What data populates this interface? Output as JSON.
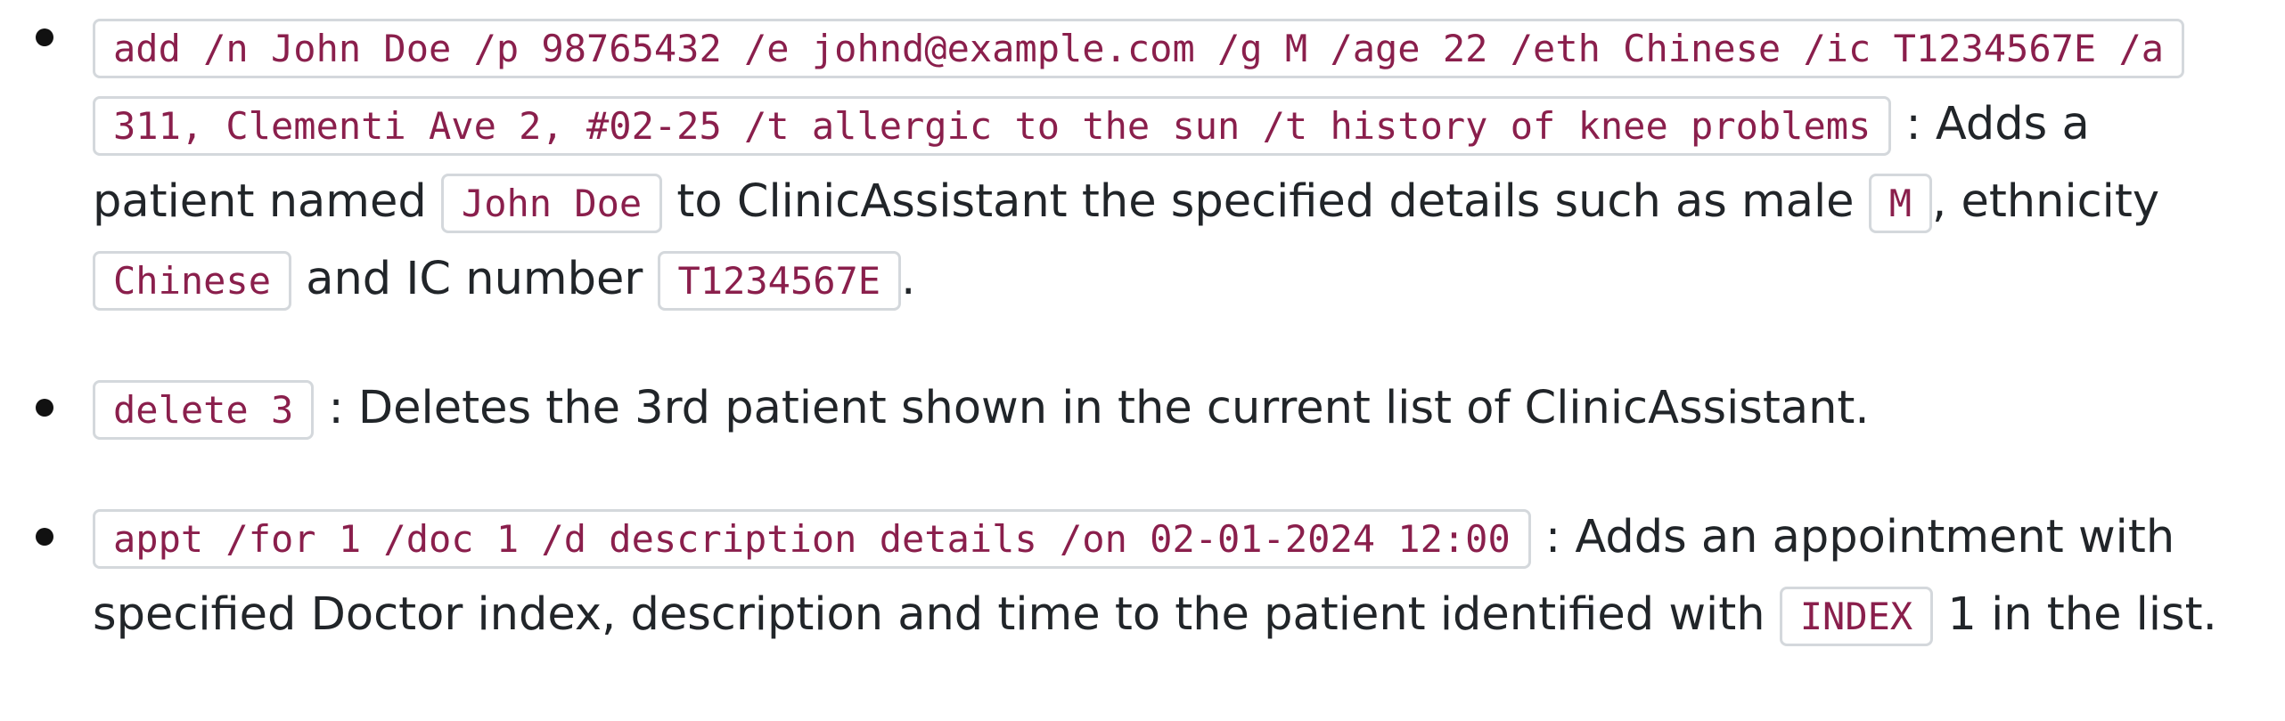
{
  "examples": [
    {
      "command": "add /n John Doe /p 98765432 /e johnd@example.com /g M /age 22 /eth Chinese /ic T1234567E /a 311, Clementi Ave 2, #02-25 /t allergic to the sun /t history of knee problems",
      "text_1": " : Adds a patient named ",
      "code_1": "John Doe",
      "text_2": " to ClinicAssistant the specified details such as male ",
      "code_2": "M",
      "text_3": ", ethnicity ",
      "code_3": "Chinese",
      "text_4": " and IC number ",
      "code_4": "T1234567E",
      "text_5": "."
    },
    {
      "command": "delete 3",
      "text_1": " : Deletes the 3rd patient shown in the current list of ClinicAssistant."
    },
    {
      "command": "appt /for 1 /doc 1 /d description details /on 02-01-2024 12:00",
      "text_1": " : Adds an appointment with specified Doctor index, description and time to the patient identified with ",
      "code_1": "INDEX",
      "text_2": " 1 in the list."
    }
  ]
}
